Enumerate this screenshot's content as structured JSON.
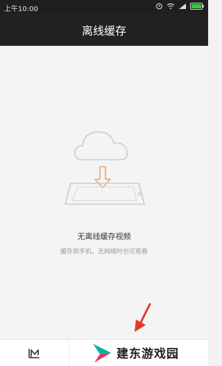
{
  "status_bar": {
    "time": "上午10:00",
    "icons": [
      "alarm-icon",
      "wifi-icon",
      "signal-icon",
      "battery-icon"
    ]
  },
  "header": {
    "title": "离线缓存"
  },
  "empty_state": {
    "title": "无离线缓存视频",
    "subtitle": "缓存到手机，无网络时也可观看"
  },
  "bottom_bar": {
    "tabs": [
      {
        "icon": "m-logo-icon"
      }
    ]
  },
  "watermark": {
    "text": "建东游戏园"
  },
  "colors": {
    "header_bg": "#222222",
    "page_bg": "#f4f4f4",
    "arrow_orange": "#f0a060",
    "pointer_red": "#e23a2a",
    "watermark_teal": "#00b3a4",
    "watermark_pink": "#e8326a"
  }
}
